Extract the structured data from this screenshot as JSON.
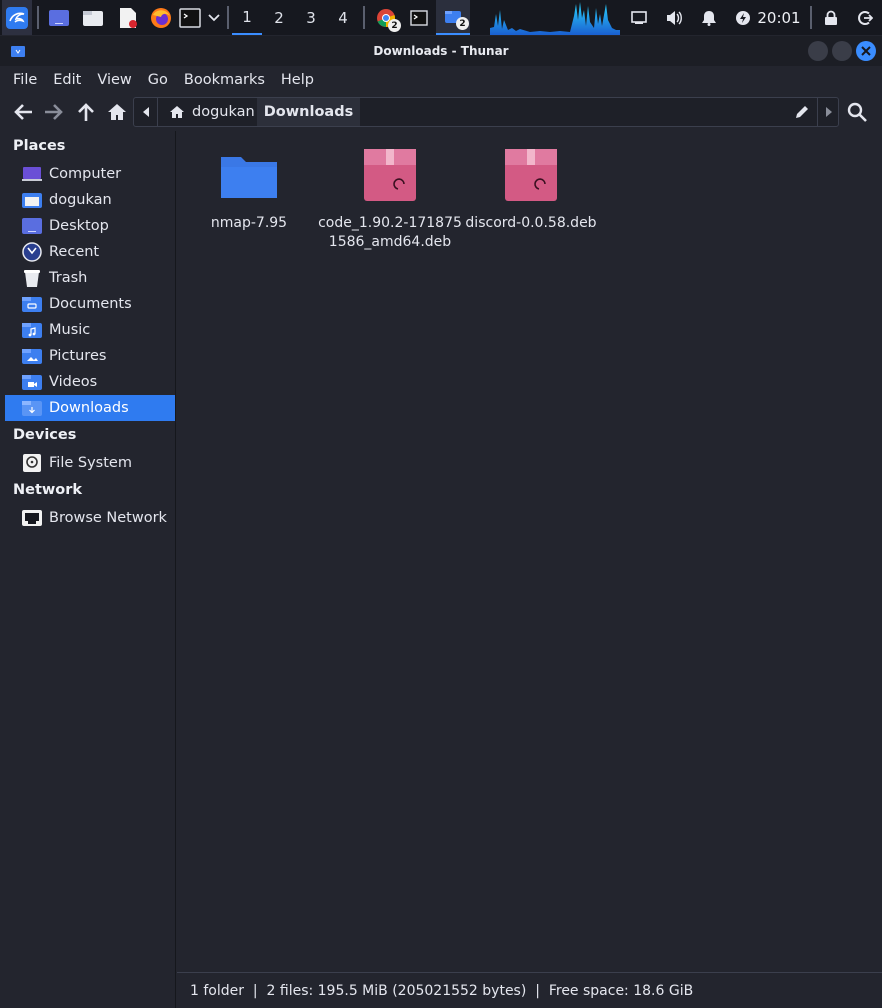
{
  "panel": {
    "workspaces": [
      "1",
      "2",
      "3",
      "4"
    ],
    "active_workspace": "1",
    "task_badges": {
      "chrome": "2",
      "thunar": "2"
    },
    "clock": "20:01"
  },
  "window": {
    "title": "Downloads - Thunar"
  },
  "menu": [
    "File",
    "Edit",
    "View",
    "Go",
    "Bookmarks",
    "Help"
  ],
  "path": {
    "home": "dogukan",
    "current": "Downloads"
  },
  "sidebar": {
    "places_heading": "Places",
    "places": [
      {
        "label": "Computer",
        "icon": "computer-icon"
      },
      {
        "label": "dogukan",
        "icon": "home-folder-icon"
      },
      {
        "label": "Desktop",
        "icon": "desktop-icon"
      },
      {
        "label": "Recent",
        "icon": "recent-icon"
      },
      {
        "label": "Trash",
        "icon": "trash-icon"
      },
      {
        "label": "Documents",
        "icon": "documents-folder-icon"
      },
      {
        "label": "Music",
        "icon": "music-folder-icon"
      },
      {
        "label": "Pictures",
        "icon": "pictures-folder-icon"
      },
      {
        "label": "Videos",
        "icon": "videos-folder-icon"
      },
      {
        "label": "Downloads",
        "icon": "downloads-folder-icon",
        "selected": true
      }
    ],
    "devices_heading": "Devices",
    "devices": [
      {
        "label": "File System",
        "icon": "drive-icon"
      }
    ],
    "network_heading": "Network",
    "network": [
      {
        "label": "Browse Network",
        "icon": "network-icon"
      }
    ]
  },
  "files": [
    {
      "name": "nmap-7.95",
      "type": "folder"
    },
    {
      "name": "code_1.90.2-1718751586_amd64.deb",
      "line1": "code_1.90.2-171875",
      "line2": "1586_amd64.deb",
      "type": "deb"
    },
    {
      "name": "discord-0.0.58.deb",
      "type": "deb"
    }
  ],
  "status": "1 folder  |  2 files: 195.5 MiB (205021552 bytes)  |  Free space: 18.6 GiB",
  "colors": {
    "accent": "#2f7bf0",
    "folder": "#3d7ff0",
    "deb": "#d35a84",
    "close": "#3a8dff"
  }
}
